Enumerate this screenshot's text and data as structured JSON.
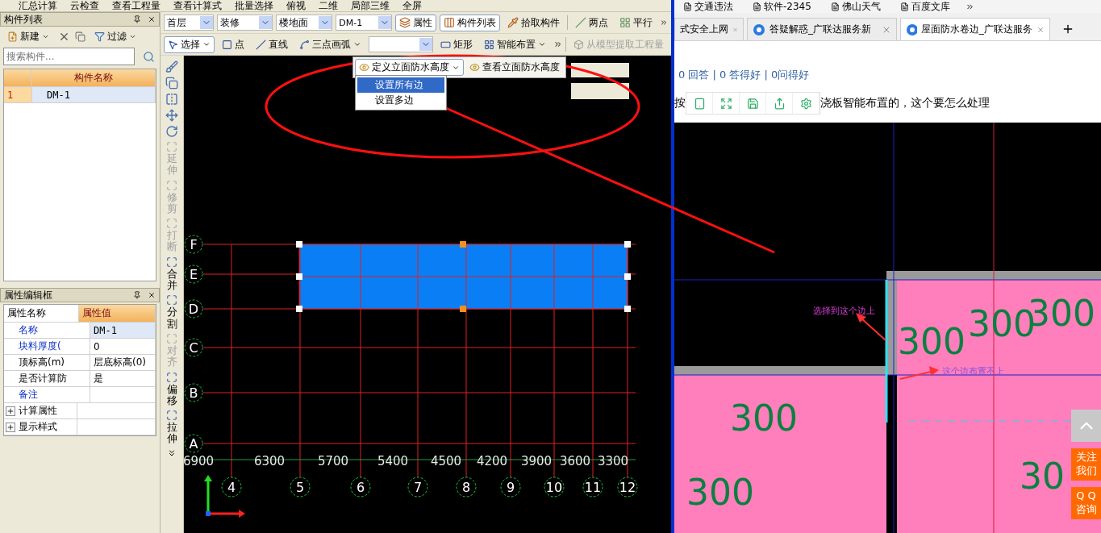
{
  "top_toolbar": {
    "items": [
      "汇总计算",
      "云检查",
      "查看工程量",
      "查看计算式",
      "批量选择"
    ],
    "view_items": [
      "俯视",
      "二维",
      "局部三维",
      "全屏"
    ]
  },
  "component_list": {
    "title": "构件列表",
    "toolbar": [
      {
        "label": "新建",
        "menu": true
      },
      {
        "label": "过滤",
        "menu": true
      }
    ],
    "search": {
      "placeholder": "搜索构件..."
    },
    "column": "构件名称",
    "rows": [
      {
        "index": "1",
        "name": "DM-1",
        "selected": true
      }
    ]
  },
  "property_editor": {
    "title": "属性编辑框",
    "columns": [
      "属性名称",
      "属性值"
    ],
    "rows": [
      {
        "kind": "public",
        "name": "名称",
        "value": "DM-1",
        "selected": true
      },
      {
        "kind": "public",
        "name": "块料厚度(",
        "value": "0",
        "selected": false
      },
      {
        "kind": "private",
        "name": "顶标高(m)",
        "value": "层底标高(0)",
        "selected": false
      },
      {
        "kind": "private",
        "name": "是否计算防",
        "value": "是",
        "selected": false
      },
      {
        "kind": "public",
        "name": "备注",
        "value": "",
        "selected": false
      },
      {
        "kind": "group",
        "name": "计算属性",
        "value": "",
        "selected": false
      },
      {
        "kind": "group",
        "name": "显示样式",
        "value": "",
        "selected": false
      }
    ]
  },
  "toolbar_1": {
    "selectors": [
      "首层",
      "装修",
      "楼地面",
      "DM-1"
    ],
    "buttons": [
      {
        "label": "属性",
        "pressed": true
      },
      {
        "label": "构件列表",
        "pressed": true
      },
      {
        "label": "拾取构件",
        "pressed": false
      }
    ],
    "draw_buttons": [
      "两点",
      "平行"
    ]
  },
  "toolbar_2": {
    "tools": [
      {
        "label": "选择",
        "menu": true,
        "pressed": true
      },
      {
        "label": "点",
        "menu": false,
        "pressed": false
      },
      {
        "label": "直线",
        "menu": false,
        "pressed": false
      },
      {
        "label": "三点画弧",
        "menu": true,
        "pressed": false
      }
    ],
    "layout_tools": [
      {
        "label": "矩形",
        "menu": false
      },
      {
        "label": "智能布置",
        "menu": true
      }
    ],
    "extract": {
      "label": "从模型提取工程量",
      "disabled": true
    }
  },
  "edit_tools": [
    {
      "label": "延伸",
      "disabled": true
    },
    {
      "label": "修剪",
      "disabled": true
    },
    {
      "label": "打断",
      "disabled": true
    },
    {
      "label": "合并",
      "disabled": false
    },
    {
      "label": "分割",
      "disabled": false
    },
    {
      "label": "对齐",
      "disabled": true
    },
    {
      "label": "偏移",
      "disabled": false
    },
    {
      "label": "拉伸",
      "disabled": false
    }
  ],
  "canvas": {
    "popup_toolbar": [
      {
        "label": "定义立面防水高度",
        "menu": true
      },
      {
        "label": "查看立面防水高度",
        "menu": false
      }
    ],
    "dropdown_menu": [
      {
        "label": "设置所有边",
        "selected": true
      },
      {
        "label": "设置多边",
        "selected": false
      }
    ],
    "row_axes": [
      "F",
      "E",
      "D",
      "C",
      "B",
      "A"
    ],
    "column_axes": [
      "4",
      "5",
      "6",
      "7",
      "8",
      "9",
      "10",
      "11",
      "12"
    ],
    "spacings": [
      "6900",
      "6300",
      "5700",
      "5400",
      "4500",
      "4200",
      "3900",
      "3600",
      "3300"
    ]
  },
  "browser": {
    "bookmarks": [
      "交通违法",
      "软件-2345",
      "佛山天气",
      "百度文库"
    ],
    "tabs": [
      {
        "title": "式安全上网",
        "selected": false
      },
      {
        "title": "答疑解惑_广联达服务新",
        "selected": false
      },
      {
        "title": "屋面防水卷边_广联达服务",
        "selected": true
      }
    ],
    "stats": "0 回答 | 0 答得好 | 0问得好",
    "question": [
      "按",
      "浇板智能布置的，这个要怎么处理"
    ],
    "screenshot": {
      "labels": [
        "300",
        "300",
        "300",
        "300",
        "300",
        "30"
      ],
      "annotations": [
        "选择到这个边上",
        "这个边布置不上"
      ]
    },
    "side_buttons": [
      {
        "lines": [
          "关注",
          "我们"
        ]
      },
      {
        "lines": [
          "Q Q",
          "咨询"
        ]
      }
    ]
  }
}
